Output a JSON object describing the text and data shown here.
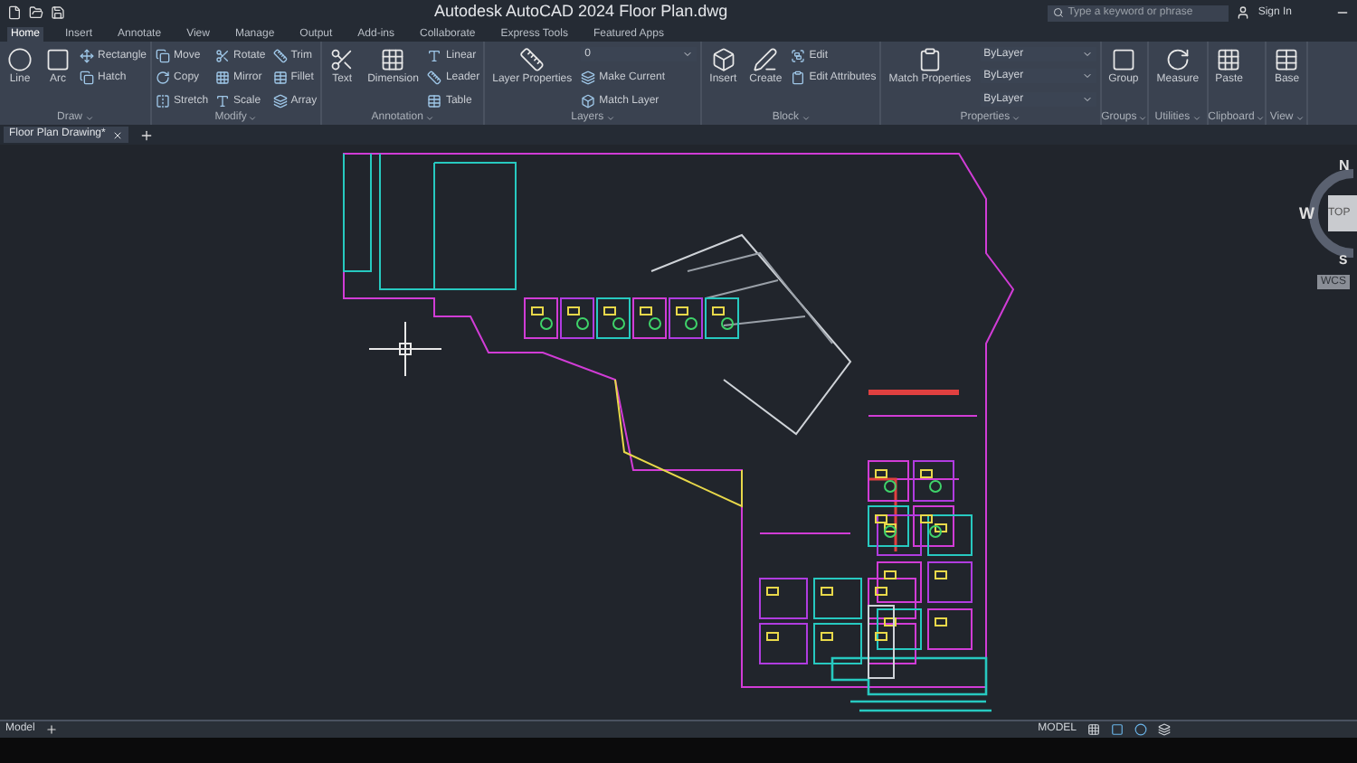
{
  "title_bar": {
    "title": "Autodesk AutoCAD 2024   Floor Plan.dwg",
    "search": {
      "placeholder": "Type a keyword or phrase"
    },
    "user": "Sign In"
  },
  "ribbon_tabs": [
    {
      "label": "Home",
      "selected": true
    },
    {
      "label": "Insert",
      "selected": false
    },
    {
      "label": "Annotate",
      "selected": false
    },
    {
      "label": "View",
      "selected": false
    },
    {
      "label": "Manage",
      "selected": false
    },
    {
      "label": "Output",
      "selected": false
    },
    {
      "label": "Add-ins",
      "selected": false
    },
    {
      "label": "Collaborate",
      "selected": false
    },
    {
      "label": "Express Tools",
      "selected": false
    },
    {
      "label": "Featured Apps",
      "selected": false
    }
  ],
  "panels": [
    {
      "label": "Draw",
      "tools": [
        {
          "kind": "large",
          "label": "Line"
        },
        {
          "kind": "large",
          "label": "Arc"
        },
        {
          "kind": "small",
          "label": "Rectangle"
        },
        {
          "kind": "small",
          "label": "Hatch"
        }
      ]
    },
    {
      "label": "Modify",
      "tools": [
        {
          "kind": "small",
          "label": "Move"
        },
        {
          "kind": "small",
          "label": "Copy"
        },
        {
          "kind": "small",
          "label": "Stretch"
        },
        {
          "kind": "small",
          "label": "Rotate"
        },
        {
          "kind": "small",
          "label": "Mirror"
        },
        {
          "kind": "small",
          "label": "Scale"
        },
        {
          "kind": "small",
          "label": "Trim"
        },
        {
          "kind": "small",
          "label": "Fillet"
        },
        {
          "kind": "small",
          "label": "Array"
        }
      ]
    },
    {
      "label": "Annotation",
      "tools": [
        {
          "kind": "large",
          "label": "Text"
        },
        {
          "kind": "large",
          "label": "Dimension"
        },
        {
          "kind": "small",
          "label": "Linear"
        },
        {
          "kind": "small",
          "label": "Leader"
        },
        {
          "kind": "small",
          "label": "Table"
        }
      ]
    },
    {
      "label": "Layers",
      "tools": [
        {
          "kind": "large",
          "label": "Layer Properties"
        },
        {
          "kind": "dropdown",
          "label": "0"
        },
        {
          "kind": "small",
          "label": "Make Current"
        },
        {
          "kind": "small",
          "label": "Match Layer"
        }
      ]
    },
    {
      "label": "Block",
      "tools": [
        {
          "kind": "large",
          "label": "Insert"
        },
        {
          "kind": "large",
          "label": "Create"
        },
        {
          "kind": "small",
          "label": "Edit"
        },
        {
          "kind": "small",
          "label": "Edit Attributes"
        }
      ]
    },
    {
      "label": "Properties",
      "tools": [
        {
          "kind": "large",
          "label": "Match Properties"
        },
        {
          "kind": "dropdown",
          "label": "ByLayer"
        },
        {
          "kind": "dropdown",
          "label": "ByLayer"
        },
        {
          "kind": "dropdown",
          "label": "ByLayer"
        }
      ]
    },
    {
      "label": "Groups",
      "tools": [
        {
          "kind": "large",
          "label": "Group"
        }
      ]
    },
    {
      "label": "Utilities",
      "tools": [
        {
          "kind": "large",
          "label": "Measure"
        }
      ]
    },
    {
      "label": "Clipboard",
      "tools": [
        {
          "kind": "large",
          "label": "Paste"
        }
      ]
    },
    {
      "label": "View",
      "tools": [
        {
          "kind": "large",
          "label": "Base"
        }
      ]
    }
  ],
  "document_tab": {
    "label": "Floor Plan Drawing*"
  },
  "viewcube": {
    "north": "N",
    "west": "W",
    "face": "TOP",
    "south": "S",
    "ucs": "WCS"
  },
  "layout_tab": {
    "label": "Model"
  },
  "status_bar": {
    "mode": "MODEL"
  }
}
